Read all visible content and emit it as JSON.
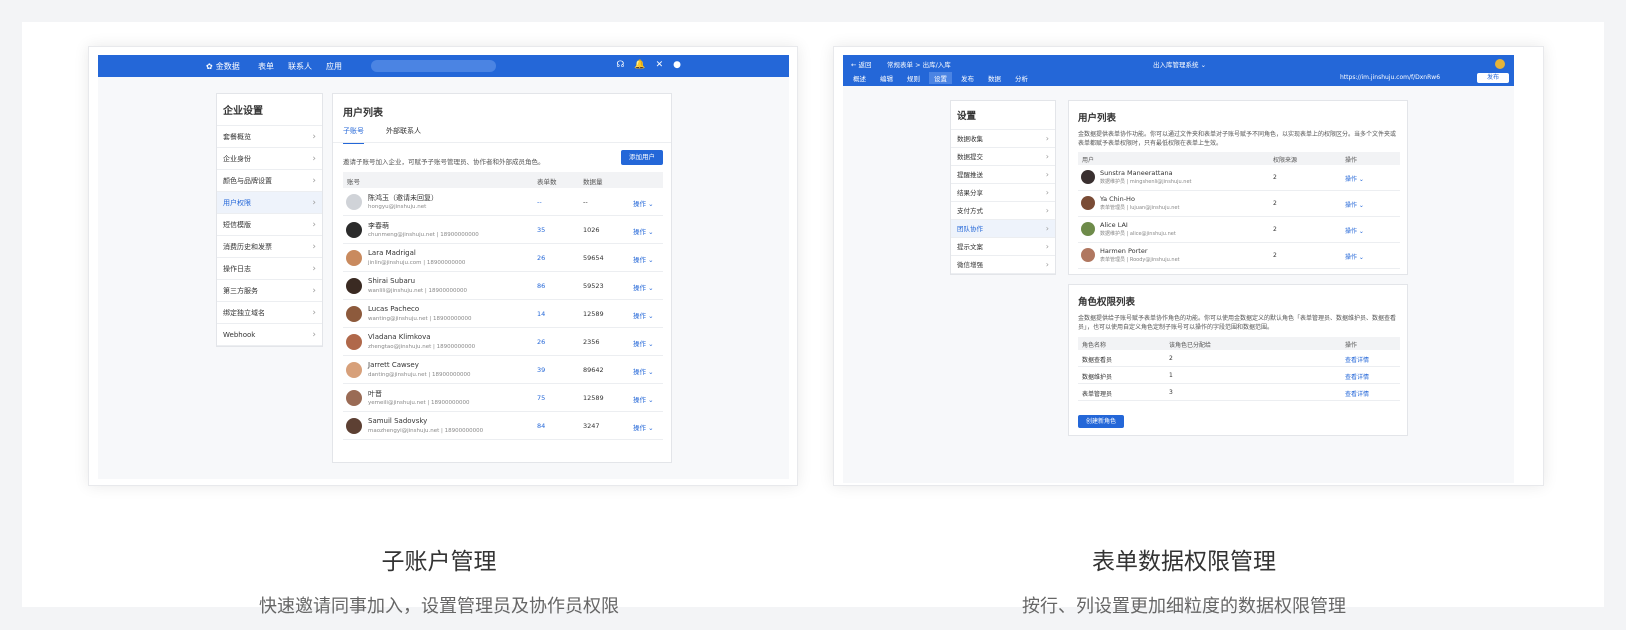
{
  "left": {
    "brand": "金数据",
    "nav": [
      "表单",
      "联系人",
      "应用"
    ],
    "top_icons": [
      "headset-icon",
      "bell-icon",
      "tools-icon",
      "avatar-icon"
    ],
    "sidebar": {
      "title": "企业设置",
      "items": [
        "套餐概览",
        "企业身份",
        "颜色与品牌设置",
        "用户权限",
        "短信模版",
        "消费历史和发票",
        "操作日志",
        "第三方服务",
        "绑定独立域名",
        "Webhook"
      ],
      "active_index": 3
    },
    "panel": {
      "title": "用户列表",
      "tabs": [
        "子账号",
        "外部联系人"
      ],
      "description": "邀请子账号加入企业，可赋予子账号管理员、协作者和外部成员角色。",
      "add_button": "添加用户",
      "columns": [
        "账号",
        "表单数",
        "数据量"
      ],
      "rows": [
        {
          "name": "陈鸿玉（邀请未回复）",
          "email": "hongyu@jinshuju.net",
          "forms": "--",
          "data": "--",
          "op": "操作",
          "avatar": "#d0d3d8"
        },
        {
          "name": "李春萌",
          "email": "chunmeng@jinshuju.net | 18900000000",
          "forms": "35",
          "data": "1026",
          "op": "操作",
          "avatar": "#2b2b2b"
        },
        {
          "name": "Lara Madrigal",
          "email": "jinlin@jinshuju.com | 18900000000",
          "forms": "26",
          "data": "59654",
          "op": "操作",
          "avatar": "#c98a5e"
        },
        {
          "name": "Shirai Subaru",
          "email": "wanlili@jinshuju.net | 18900000000",
          "forms": "86",
          "data": "59523",
          "op": "操作",
          "avatar": "#3a2a22"
        },
        {
          "name": "Lucas Pacheco",
          "email": "wanting@jinshuju.net | 18900000000",
          "forms": "14",
          "data": "12589",
          "op": "操作",
          "avatar": "#8d5a3c"
        },
        {
          "name": "Vladana Klimkova",
          "email": "zhengtao@jinshuju.net | 18900000000",
          "forms": "26",
          "data": "2356",
          "op": "操作",
          "avatar": "#b0684a"
        },
        {
          "name": "Jarrett Cawsey",
          "email": "danting@jinshuju.net | 18900000000",
          "forms": "39",
          "data": "89642",
          "op": "操作",
          "avatar": "#d7a07a"
        },
        {
          "name": "叶晋",
          "email": "yemeili@jinshuju.net | 18900000000",
          "forms": "75",
          "data": "12589",
          "op": "操作",
          "avatar": "#9a6b55"
        },
        {
          "name": "Samuil Sadovsky",
          "email": "maozhengyi@jinshuju.net | 18900000000",
          "forms": "84",
          "data": "3247",
          "op": "操作",
          "avatar": "#5d4033"
        }
      ]
    },
    "caption_title": "子账户管理",
    "caption_sub": "快速邀请同事加入，设置管理员及协作员权限"
  },
  "right": {
    "back": "返回",
    "crumb": "常规表单 > 出库/入库",
    "center_title": "出入库管理系统",
    "tabs": [
      "概述",
      "编辑",
      "规则",
      "设置",
      "发布",
      "数据",
      "分析"
    ],
    "active_tab": 3,
    "url": "https://im.jinshuju.com/f/DxnRw6",
    "publish": "发布",
    "sidebar": {
      "title": "设置",
      "items": [
        "数据收集",
        "数据提交",
        "提醒推送",
        "结果分享",
        "支付方式",
        "团队协作",
        "提示文案",
        "微信增强"
      ],
      "active_index": 5
    },
    "user_panel": {
      "title": "用户列表",
      "description": "金数据提供表单协作功能。你可以通过文件夹和表单对子账号赋予不同角色，以实现表单上的权限区分。当多个文件夹或表单都赋予表单权限时，只有最低权限在表单上生效。",
      "columns": [
        "用户",
        "权限来源",
        "操作"
      ],
      "rows": [
        {
          "name": "Sunstra Maneerattana",
          "email": "数据维护员 | mingshenli@jinshuju.net",
          "count": "2",
          "op": "操作",
          "avatar": "#3a3030"
        },
        {
          "name": "Ya Chin-Ho",
          "email": "表单管理员 | lujuan@jinshuju.net",
          "count": "2",
          "op": "操作",
          "avatar": "#7a4c36"
        },
        {
          "name": "Alice LAI",
          "email": "数据维护员 | alice@jinshuju.net",
          "count": "2",
          "op": "操作",
          "avatar": "#6e8b4a"
        },
        {
          "name": "Harmen Porter",
          "email": "表单管理员 | Roody@jinshuju.net",
          "count": "2",
          "op": "操作",
          "avatar": "#b07760"
        }
      ]
    },
    "role_panel": {
      "title": "角色权限列表",
      "description": "金数据提供给子账号赋予表单协作角色的功能。你可以使用金数据定义的默认角色「表单管理员、数据维护员、数据查看员」，也可以使用自定义角色定制子账号可以操作的字段范围和数据范围。",
      "columns": [
        "角色名称",
        "该角色已分配给",
        "操作"
      ],
      "rows": [
        {
          "name": "数据查看员",
          "count": "2",
          "op": "查看详情"
        },
        {
          "name": "数据维护员",
          "count": "1",
          "op": "查看详情"
        },
        {
          "name": "表单管理员",
          "count": "3",
          "op": "查看详情"
        }
      ],
      "create_button": "创建新角色"
    },
    "caption_title": "表单数据权限管理",
    "caption_sub": "按行、列设置更加细粒度的数据权限管理"
  }
}
